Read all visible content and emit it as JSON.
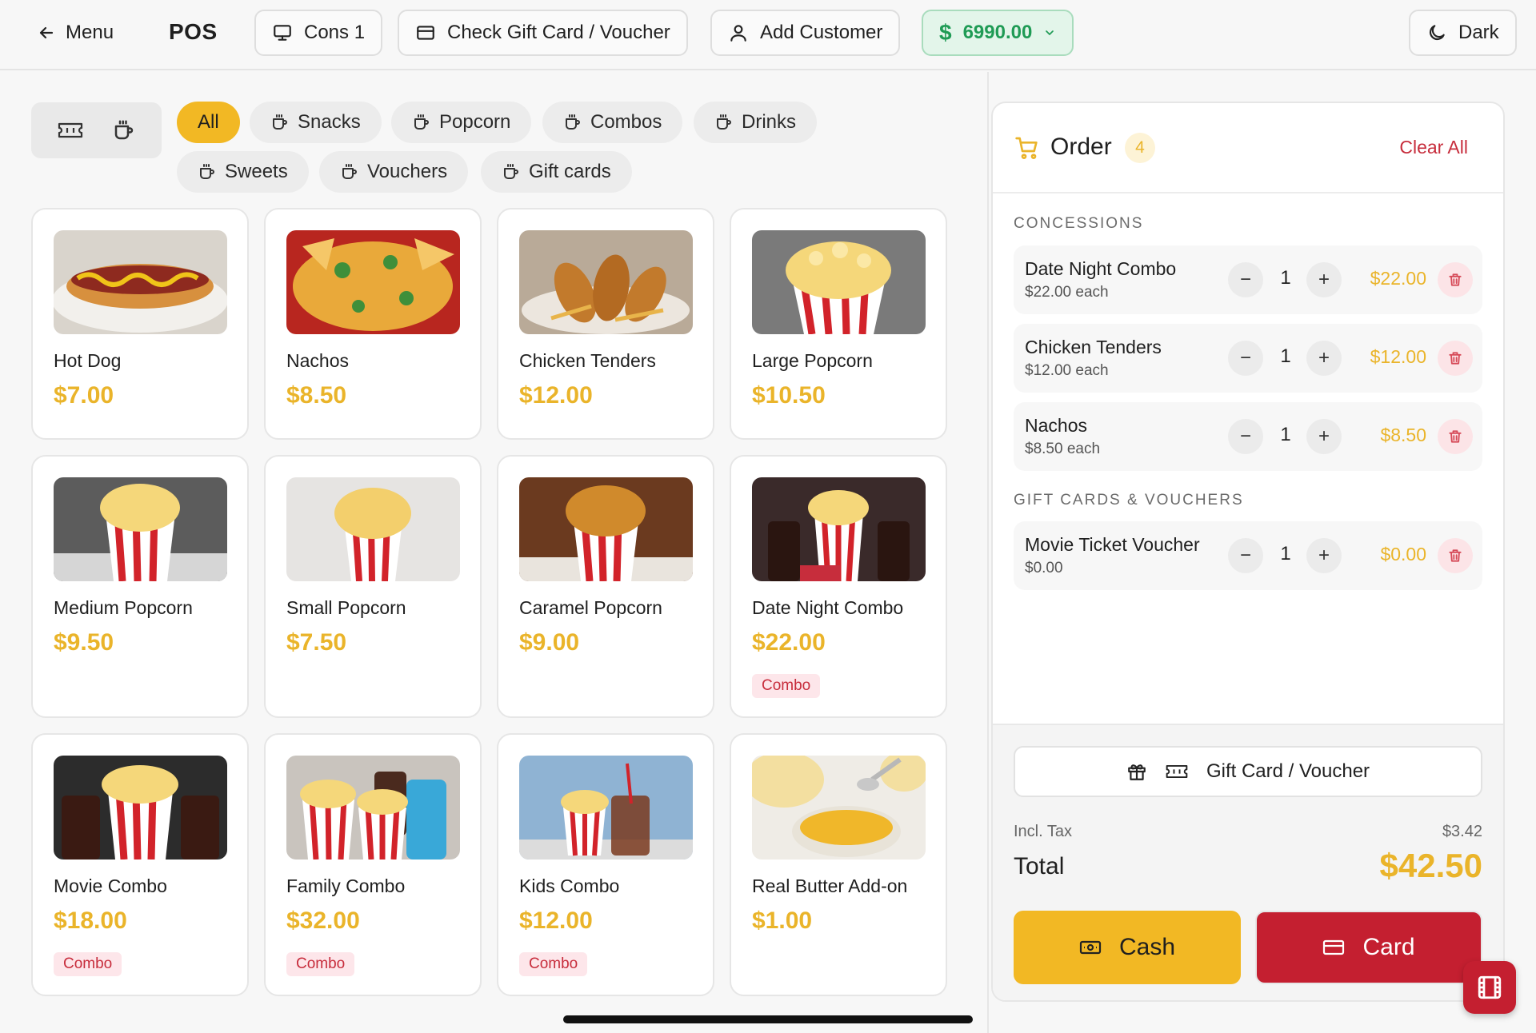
{
  "header": {
    "menu_label": "Menu",
    "title": "POS",
    "terminal_label": "Cons 1",
    "check_gift_label": "Check Gift Card / Voucher",
    "add_customer_label": "Add Customer",
    "cash_drawer_amount": "6990.00",
    "theme_label": "Dark"
  },
  "categories": [
    {
      "label": "All",
      "active": true
    },
    {
      "label": "Snacks"
    },
    {
      "label": "Popcorn"
    },
    {
      "label": "Combos"
    },
    {
      "label": "Drinks"
    },
    {
      "label": "Sweets"
    },
    {
      "label": "Vouchers"
    },
    {
      "label": "Gift cards"
    }
  ],
  "products": [
    {
      "name": "Hot Dog",
      "price": "$7.00",
      "icon": "hot-dog-photo"
    },
    {
      "name": "Nachos",
      "price": "$8.50",
      "icon": "nachos-photo"
    },
    {
      "name": "Chicken Tenders",
      "price": "$12.00",
      "icon": "chicken-tenders-photo"
    },
    {
      "name": "Large Popcorn",
      "price": "$10.50",
      "icon": "popcorn-photo"
    },
    {
      "name": "Medium Popcorn",
      "price": "$9.50",
      "icon": "popcorn-photo"
    },
    {
      "name": "Small Popcorn",
      "price": "$7.50",
      "icon": "popcorn-photo"
    },
    {
      "name": "Caramel Popcorn",
      "price": "$9.00",
      "icon": "popcorn-photo"
    },
    {
      "name": "Date Night Combo",
      "price": "$22.00",
      "tag": "Combo",
      "icon": "combo-photo"
    },
    {
      "name": "Movie Combo",
      "price": "$18.00",
      "tag": "Combo",
      "icon": "combo-photo"
    },
    {
      "name": "Family Combo",
      "price": "$32.00",
      "tag": "Combo",
      "icon": "combo-photo"
    },
    {
      "name": "Kids Combo",
      "price": "$12.00",
      "tag": "Combo",
      "icon": "combo-photo"
    },
    {
      "name": "Real Butter Add-on",
      "price": "$1.00",
      "icon": "butter-photo"
    }
  ],
  "order": {
    "title": "Order",
    "count": "4",
    "clear_label": "Clear All",
    "sections": [
      {
        "label": "CONCESSIONS",
        "items": [
          {
            "name": "Date Night Combo",
            "unit": "$22.00 each",
            "qty": "1",
            "total": "$22.00"
          },
          {
            "name": "Chicken Tenders",
            "unit": "$12.00 each",
            "qty": "1",
            "total": "$12.00"
          },
          {
            "name": "Nachos",
            "unit": "$8.50 each",
            "qty": "1",
            "total": "$8.50"
          }
        ]
      },
      {
        "label": "GIFT CARDS & VOUCHERS",
        "items": [
          {
            "name": "Movie Ticket Voucher",
            "unit": "$0.00",
            "qty": "1",
            "total": "$0.00"
          }
        ]
      }
    ],
    "gift_button_label": "Gift Card / Voucher",
    "tax_label": "Incl. Tax",
    "tax_value": "$3.42",
    "total_label": "Total",
    "total_value": "$42.50",
    "cash_label": "Cash",
    "card_label": "Card"
  },
  "colors": {
    "accent_yellow": "#f2b824",
    "price_yellow": "#eab42a",
    "brand_red": "#c41f30",
    "cash_green": "#1f9b55"
  }
}
